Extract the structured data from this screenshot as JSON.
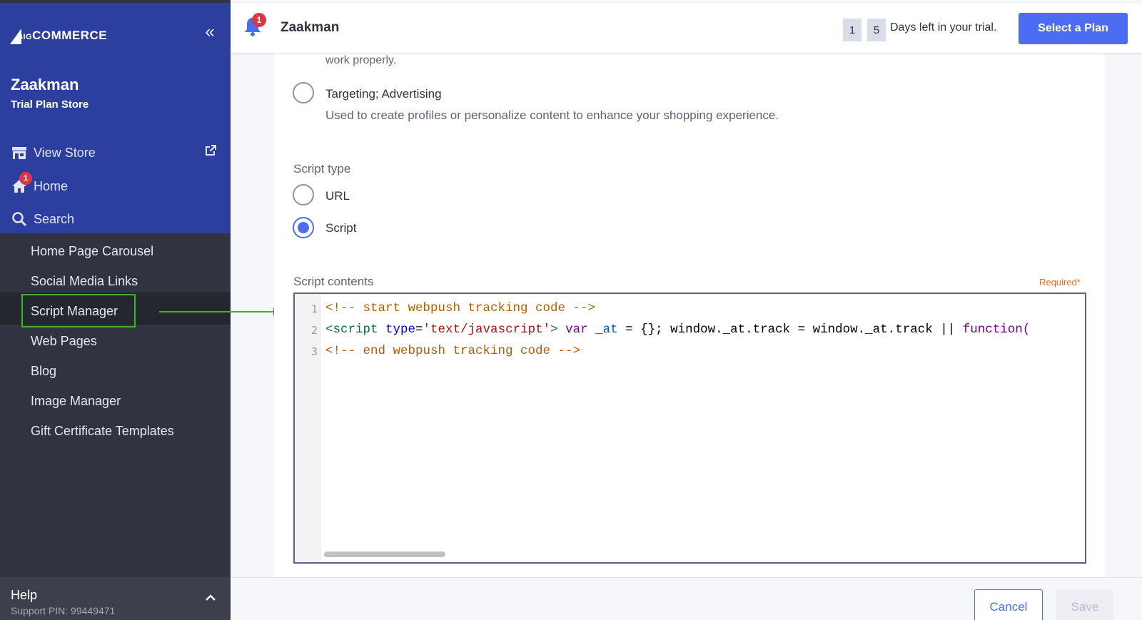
{
  "brand": {
    "logo_big": "BIG",
    "logo_rest": "COMMERCE"
  },
  "sidebar": {
    "store_name": "Zaakman",
    "store_plan": "Trial Plan Store",
    "nav": [
      {
        "label": "View Store",
        "icon": "store-icon"
      },
      {
        "label": "Home",
        "icon": "home-icon",
        "badge": "1"
      },
      {
        "label": "Search",
        "icon": "search-icon"
      }
    ],
    "sub_items": [
      "Home Page Carousel",
      "Social Media Links",
      "Script Manager",
      "Web Pages",
      "Blog",
      "Image Manager",
      "Gift Certificate Templates"
    ],
    "help": {
      "title": "Help",
      "pin": "Support PIN: 99449471"
    }
  },
  "header": {
    "notification_count": "1",
    "store_name": "Zaakman",
    "days_left": [
      "1",
      "5"
    ],
    "trial_text": "Days left in your trial.",
    "plan_button": "Select a Plan"
  },
  "form": {
    "prev_desc_tail": "work properly.",
    "targeting": {
      "label": "Targeting; Advertising",
      "desc": "Used to create profiles or personalize content to enhance your shopping experience."
    },
    "script_type": {
      "label": "Script type",
      "options": [
        {
          "label": "URL",
          "checked": false
        },
        {
          "label": "Script",
          "checked": true
        }
      ]
    },
    "script_contents": {
      "label": "Script contents",
      "required": "Required*",
      "lines": [
        {
          "num": "1",
          "comment": "<!-- start webpush tracking code -->"
        },
        {
          "num": "2",
          "tag_open": "<script",
          "attr": " type",
          "eq": "=",
          "str": "'text/javascript'",
          "tag_close": ">",
          "kw1": " var",
          "var1": " _at",
          "rest": " = {}; window._at.track = window._at.track || ",
          "kw2": "function("
        },
        {
          "num": "3",
          "comment": "<!-- end webpush tracking code -->"
        }
      ]
    }
  },
  "footer": {
    "cancel": "Cancel",
    "save": "Save"
  },
  "colors": {
    "accent": "#4c6df2",
    "sidebar_top": "#2c3f9e",
    "sidebar": "#313440",
    "highlight": "#43b02a",
    "badge": "#db3643"
  }
}
